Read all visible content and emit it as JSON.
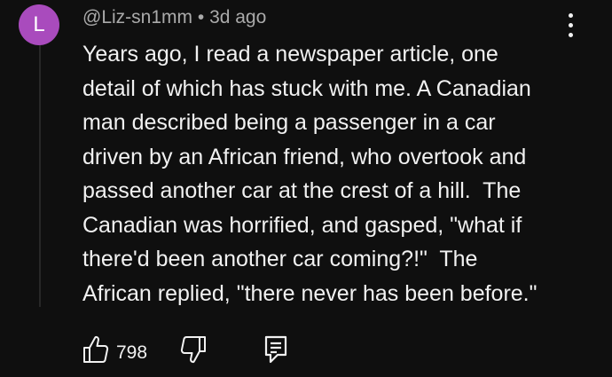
{
  "comment": {
    "avatar_letter": "L",
    "avatar_color": "#a94bbd",
    "author": "@Liz-sn1mm",
    "separator": "•",
    "time_ago": "3d ago",
    "text_lines": [
      "Years ago, I read a newspaper article, one",
      "detail of which has stuck with me. A Canadian",
      "man described being a passenger in a car",
      "driven by an African friend, who overtook and",
      "passed another car at the crest of a hill.  The",
      "Canadian was horrified, and gasped, \"what if",
      "there'd been another car coming?!\"  The",
      "African replied, \"there never has been before.\""
    ]
  },
  "actions": {
    "like_count": "798",
    "like_icon": "thumbs-up-icon",
    "dislike_icon": "thumbs-down-icon",
    "reply_icon": "reply-comment-icon"
  },
  "menu": {
    "icon": "more-vert-icon"
  }
}
